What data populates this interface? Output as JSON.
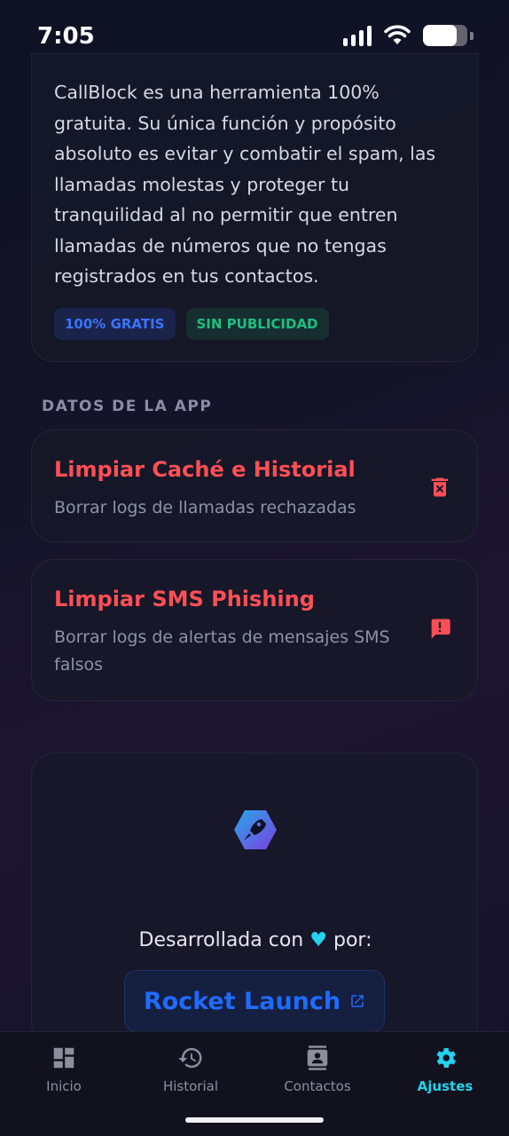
{
  "status_bar": {
    "time": "7:05",
    "battery_level_percent": 75
  },
  "about": {
    "text": "CallBlock es una herramienta 100% gratuita. Su única función y propósito absoluto es evitar y combatir el spam, las llamadas molestas y proteger tu tranquilidad al no permitir que entren llamadas de números que no tengas registrados en tus contactos.",
    "chips": [
      {
        "label": "100% GRATIS",
        "color": "#3a74ff"
      },
      {
        "label": "SIN PUBLICIDAD",
        "color": "#1fbf7f"
      }
    ]
  },
  "data_section": {
    "title": "DATOS DE LA APP",
    "actions": [
      {
        "title": "Limpiar Caché e Historial",
        "subtitle": "Borrar logs de llamadas rechazadas",
        "icon": "trash-x-icon"
      },
      {
        "title": "Limpiar SMS Phishing",
        "subtitle": "Borrar logs de alertas de mensajes SMS falsos",
        "icon": "sms-alert-icon"
      }
    ]
  },
  "developer": {
    "prefix": "Desarrollada con",
    "heart": "♥",
    "suffix": "por:",
    "link_label": "Rocket Launch",
    "logo_icon": "rocket-logo-icon"
  },
  "bottom_nav": {
    "items": [
      {
        "label": "Inicio",
        "icon": "dashboard-icon",
        "active": false
      },
      {
        "label": "Historial",
        "icon": "history-icon",
        "active": false
      },
      {
        "label": "Contactos",
        "icon": "contacts-icon",
        "active": false
      },
      {
        "label": "Ajustes",
        "icon": "gear-icon",
        "active": true
      }
    ]
  },
  "colors": {
    "accent": "#22d3ee",
    "danger": "#ff4f55",
    "link": "#1f6bff"
  }
}
